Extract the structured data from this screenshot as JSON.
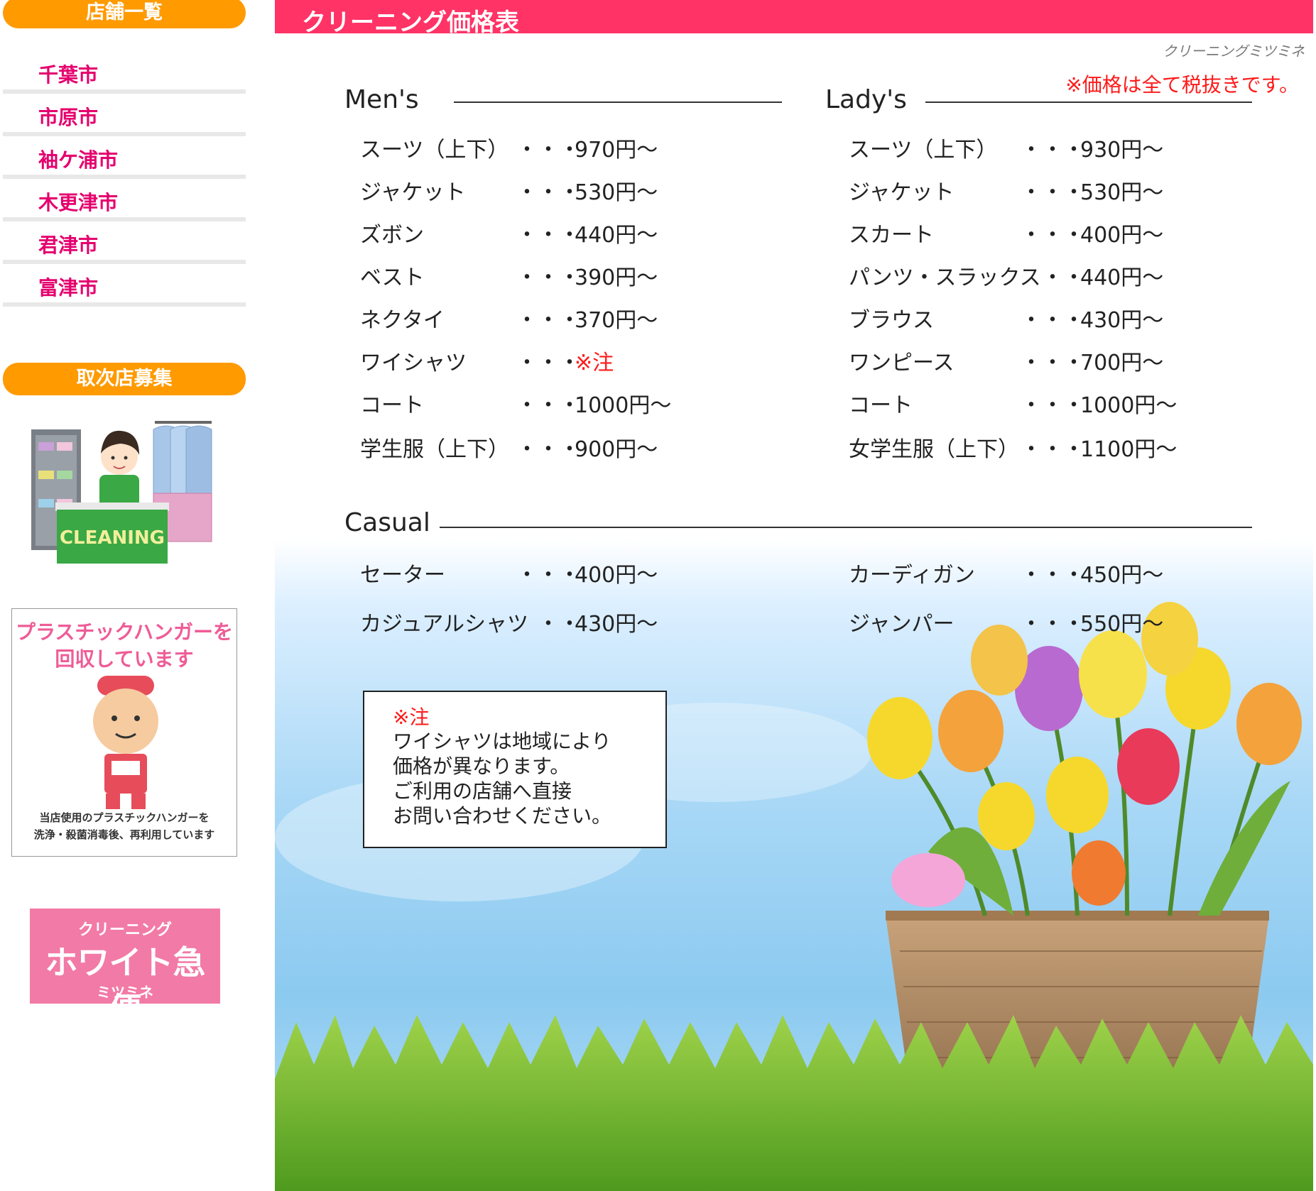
{
  "sidebar": {
    "store_list_label": "店舗一覧",
    "cities": [
      "千葉市",
      "市原市",
      "袖ケ浦市",
      "木更津市",
      "君津市",
      "富津市"
    ],
    "recruit_label": "取次店募集",
    "cleaning_sign": "CLEANING",
    "hanger": {
      "title_line1": "プラスチックハンガーを",
      "title_line2": "回収しています",
      "note_line1": "当店使用のプラスチックハンガーを",
      "note_line2": "洗浄・殺菌消毒後、再利用しています"
    },
    "logo": {
      "top": "クリーニング",
      "main": "ホワイト急便",
      "bottom": "ミツミネ"
    }
  },
  "main": {
    "title": "クリーニング価格表",
    "brand": "クリーニングミツミネ",
    "tax_note": "※価格は全て税抜きです。",
    "dots": "・・・",
    "mens": {
      "title": "Men's",
      "items": [
        {
          "name": "スーツ（上下）",
          "dots": "・・・",
          "price": "970円〜"
        },
        {
          "name": "ジャケット",
          "dots": "・・・",
          "price": "530円〜"
        },
        {
          "name": "ズボン",
          "dots": "・・・",
          "price": "440円〜"
        },
        {
          "name": "ベスト",
          "dots": "・・・",
          "price": "390円〜"
        },
        {
          "name": "ネクタイ",
          "dots": "・・・",
          "price": "370円〜"
        },
        {
          "name": "ワイシャツ",
          "dots": "・・・",
          "price": "※注"
        },
        {
          "name": "コート",
          "dots": "・・・",
          "price": "1000円〜"
        },
        {
          "name": "学生服（上下）",
          "dots": "・・・",
          "price": "900円〜"
        }
      ]
    },
    "ladys": {
      "title": "Lady's",
      "items": [
        {
          "name": "スーツ（上下）",
          "dots": "・・・",
          "price": "930円〜"
        },
        {
          "name": "ジャケット",
          "dots": "・・・",
          "price": "530円〜"
        },
        {
          "name": "スカート",
          "dots": "・・・",
          "price": "400円〜"
        },
        {
          "name": "パンツ・スラックス",
          "dots": "・・",
          "price": "440円〜"
        },
        {
          "name": "ブラウス",
          "dots": "・・・",
          "price": "430円〜"
        },
        {
          "name": "ワンピース",
          "dots": "・・・",
          "price": "700円〜"
        },
        {
          "name": "コート",
          "dots": "・・・",
          "price": "1000円〜"
        },
        {
          "name": "女学生服（上下）",
          "dots": "・・・",
          "price": "1100円〜"
        }
      ]
    },
    "casual": {
      "title": "Casual",
      "left": [
        {
          "name": "セーター",
          "dots": "・・・",
          "price": "400円〜"
        },
        {
          "name": "カジュアルシャツ",
          "dots": "・・",
          "price": "430円〜"
        }
      ],
      "right": [
        {
          "name": "カーディガン",
          "dots": "・・・",
          "price": "450円〜"
        },
        {
          "name": "ジャンパー",
          "dots": "・・・",
          "price": "550円〜"
        }
      ]
    },
    "notice": {
      "head": "※注",
      "line1": "ワイシャツは地域により",
      "line2": "価格が異なります。",
      "line3": "ご利用の店舗へ直接",
      "line4": "お問い合わせください。"
    }
  }
}
